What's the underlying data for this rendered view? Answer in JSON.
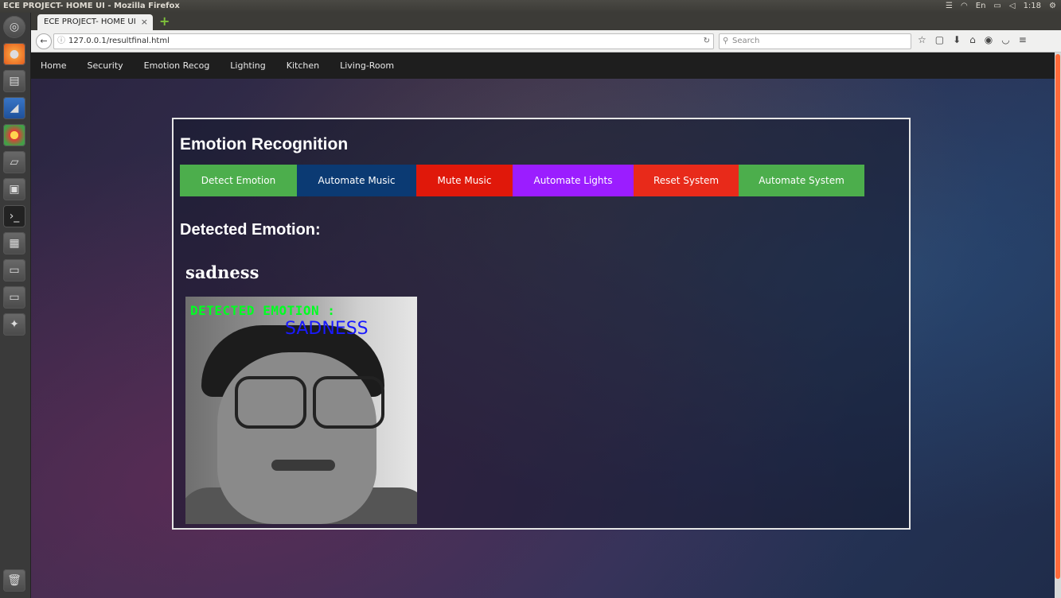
{
  "os": {
    "window_title": "ECE PROJECT- HOME UI - Mozilla Firefox",
    "clock": "1:18",
    "keyboard_layout": "En"
  },
  "browser": {
    "tab_title": "ECE PROJECT- HOME UI",
    "tab_close": "×",
    "new_tab": "+",
    "url": "127.0.0.1/resultfinal.html",
    "search_placeholder": "Search"
  },
  "site_nav": {
    "items": [
      "Home",
      "Security",
      "Emotion Recog",
      "Lighting",
      "Kitchen",
      "Living-Room"
    ]
  },
  "main": {
    "heading": "Emotion Recognition",
    "buttons": [
      {
        "label": "Detect Emotion",
        "color": "#4cae4c"
      },
      {
        "label": "Automate Music",
        "color": "#0b3a73"
      },
      {
        "label": "Mute Music",
        "color": "#e0180a"
      },
      {
        "label": "Automate Lights",
        "color": "#9b1dff"
      },
      {
        "label": "Reset System",
        "color": "#e82a1a"
      },
      {
        "label": "Automate System",
        "color": "#4cae4c"
      }
    ],
    "detected_heading": "Detected Emotion:",
    "detected_value": "sadness",
    "image_caption_line1": "DETECTED EMOTION :",
    "image_caption_line2": "SADNESS"
  }
}
